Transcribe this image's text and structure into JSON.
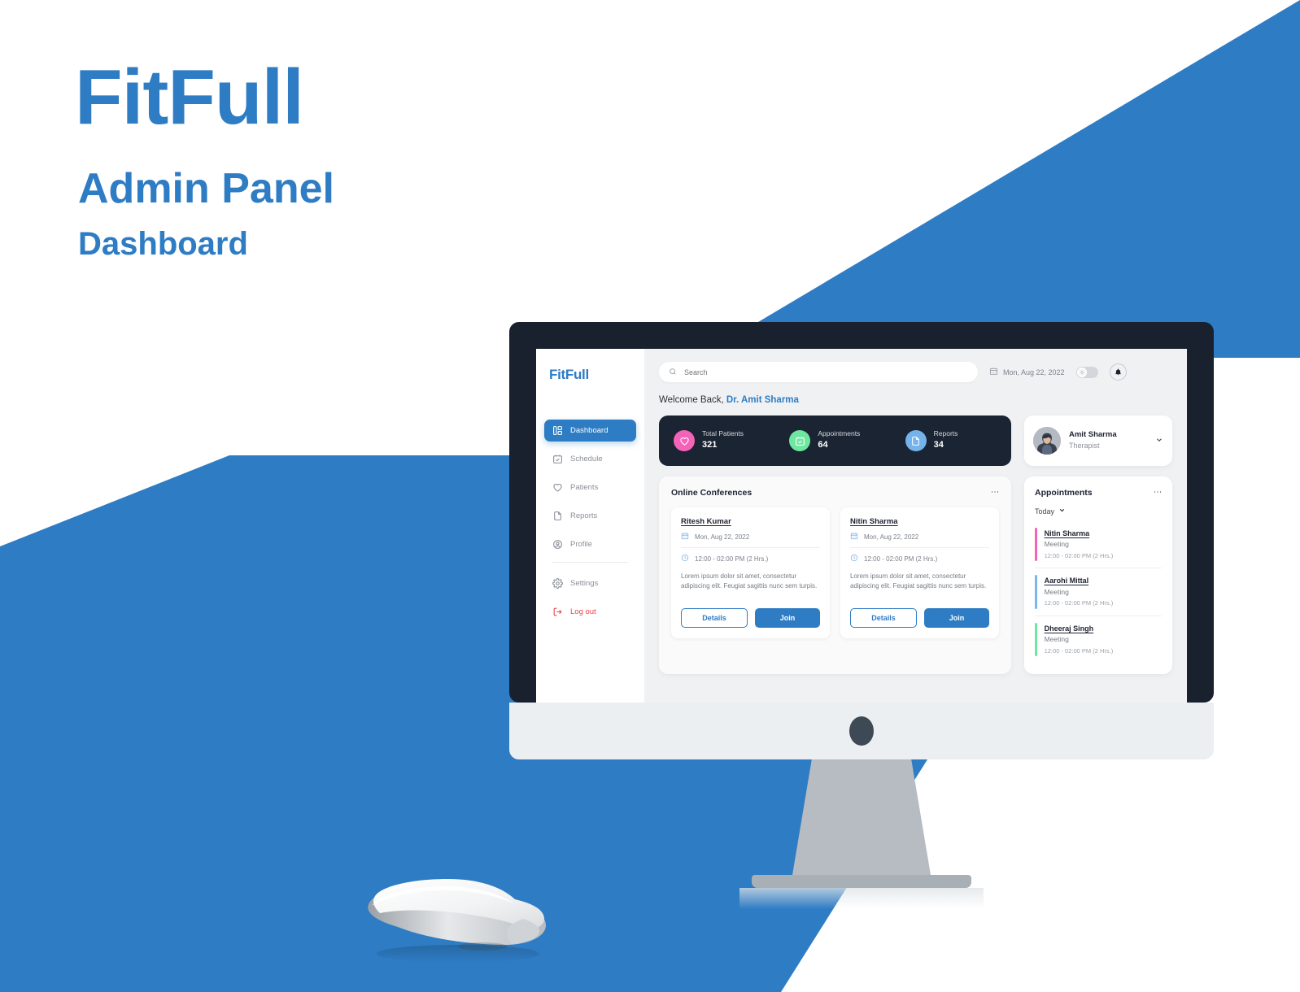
{
  "poster": {
    "brand": "FitFull",
    "subtitle": "Admin Panel",
    "subtitle2": "Dashboard",
    "accent_color": "#2e7cc4"
  },
  "app": {
    "sidebar": {
      "logo": "FitFull",
      "items": [
        {
          "label": "Dashboard",
          "icon": "dashboard-grid-icon",
          "active": true
        },
        {
          "label": "Schedule",
          "icon": "calendar-check-icon",
          "active": false
        },
        {
          "label": "Patients",
          "icon": "heart-icon",
          "active": false
        },
        {
          "label": "Reports",
          "icon": "file-icon",
          "active": false
        },
        {
          "label": "Profile",
          "icon": "user-circle-icon",
          "active": false
        }
      ],
      "settings": {
        "label": "Settings",
        "icon": "gear-icon"
      },
      "logout": {
        "label": "Log out",
        "icon": "logout-icon",
        "color": "#e8444e"
      }
    },
    "topbar": {
      "search_placeholder": "Search",
      "search_value": "",
      "date": "Mon, Aug 22, 2022",
      "theme_toggle": "off",
      "notifications_icon": "bell-icon"
    },
    "welcome": {
      "prefix": "Welcome Back, ",
      "name": "Dr. Amit Sharma"
    },
    "stats": [
      {
        "label": "Total Patients",
        "value": "321",
        "icon": "heart-icon",
        "color": "#f563b8"
      },
      {
        "label": "Appointments",
        "value": "64",
        "icon": "calendar-check-icon",
        "color": "#6ee7a0"
      },
      {
        "label": "Reports",
        "value": "34",
        "icon": "file-icon",
        "color": "#74b4ea"
      }
    ],
    "profile": {
      "name": "Amit Sharma",
      "role": "Therapist",
      "chevron": "chevron-down-icon"
    },
    "conferences": {
      "title": "Online Conferences",
      "menu_icon": "kebab-menu-icon",
      "cards": [
        {
          "name": "Ritesh Kumar",
          "date": "Mon, Aug 22, 2022",
          "time": "12:00 - 02:00 PM (2 Hrs.)",
          "description": "Lorem ipsum dolor sit amet, consectetur adipiscing elit. Feugiat sagittis nunc sem turpis.",
          "details_label": "Details",
          "join_label": "Join"
        },
        {
          "name": "Nitin Sharma",
          "date": "Mon, Aug 22, 2022",
          "time": "12:00 - 02:00 PM (2 Hrs.)",
          "description": "Lorem ipsum dolor sit amet, consectetur adipiscing elit. Feugiat sagittis nunc sem turpis.",
          "details_label": "Details",
          "join_label": "Join"
        }
      ]
    },
    "appointments": {
      "title": "Appointments",
      "menu_icon": "kebab-menu-icon",
      "filter": "Today",
      "filter_chevron": "chevron-down-icon",
      "items": [
        {
          "name": "Nitin Sharma",
          "type": "Meeting",
          "time": "12:00 - 02:00 PM (2 Hrs.)",
          "color": "#f563b8"
        },
        {
          "name": "Aarohi Mittal",
          "type": "Meeting",
          "time": "12:00 - 02:00 PM (2 Hrs.)",
          "color": "#7ab6f0"
        },
        {
          "name": "Dheeraj Singh",
          "type": "Meeting",
          "time": "12:00 - 02:00 PM (2 Hrs.)",
          "color": "#6ee7a0"
        }
      ]
    }
  }
}
